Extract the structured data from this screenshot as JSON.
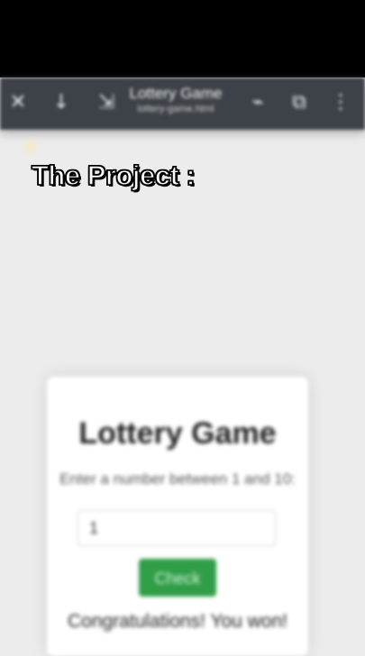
{
  "overlay_caption": "The Project :",
  "toolbar": {
    "title": "Lottery Game",
    "subtitle": "lottery-game.html",
    "icons": [
      "close-icon",
      "down-arrow-icon",
      "wrap-icon",
      "share-icon",
      "tabs-icon",
      "more-icon"
    ]
  },
  "app": {
    "title": "Lottery Game",
    "instruction": "Enter a number between 1 and 10:",
    "input_value": "1",
    "button_label": "Check",
    "result": "Congratulations! You won!",
    "accent_color": "#2f9e47"
  }
}
